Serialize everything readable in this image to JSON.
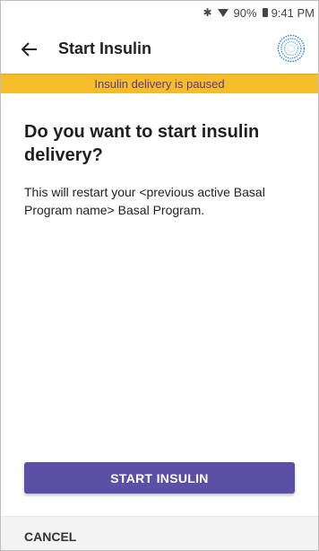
{
  "status_bar": {
    "battery": "90%",
    "time": "9:41 PM",
    "icons": [
      "bluetooth-icon",
      "wifi-icon",
      "battery-icon"
    ]
  },
  "app_bar": {
    "back_icon": "back-arrow-icon",
    "title": "Start Insulin",
    "pod_icon": "pod-status-icon"
  },
  "banner": {
    "text": "Insulin delivery is paused",
    "color": "#f5bd2b"
  },
  "main": {
    "heading": "Do you want to start insulin delivery?",
    "body": "This will restart your <previous active Basal Program name> Basal Program."
  },
  "actions": {
    "primary_label": "START INSULIN",
    "primary_color": "#5b4fa6",
    "cancel_label": "CANCEL"
  }
}
